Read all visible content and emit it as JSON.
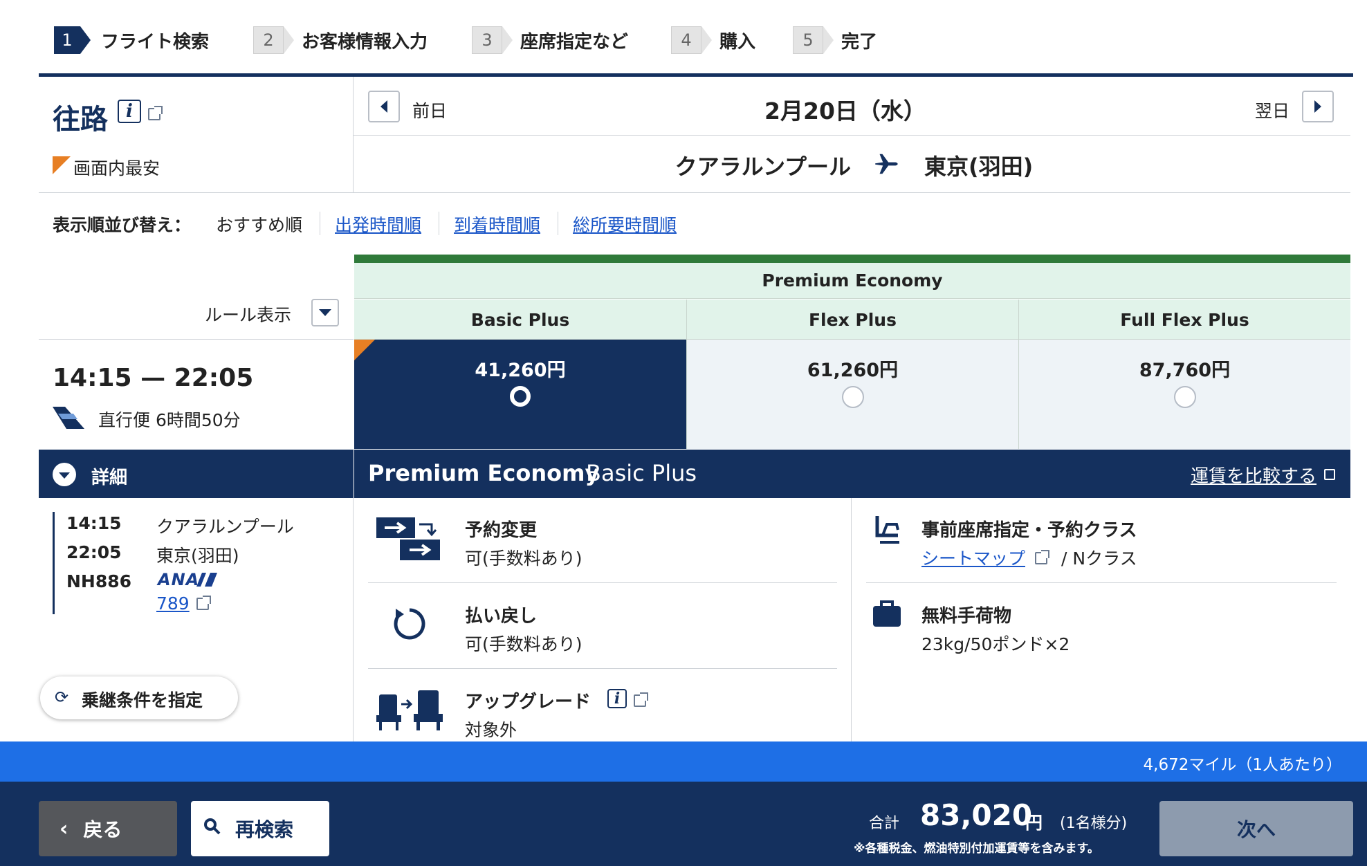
{
  "steps": [
    {
      "num": "1",
      "label": "フライト検索"
    },
    {
      "num": "2",
      "label": "お客様情報入力"
    },
    {
      "num": "3",
      "label": "座席指定など"
    },
    {
      "num": "4",
      "label": "購入"
    },
    {
      "num": "5",
      "label": "完了"
    }
  ],
  "header": {
    "direction": "往路",
    "info_glyph": "i",
    "cheapest_label": "画面内最安",
    "prev_day": "前日",
    "date": "2月20日（水）",
    "next_day": "翌日",
    "origin": "クアラルンプール",
    "destination": "東京(羽田)"
  },
  "sort": {
    "label": "表示順並び替え：",
    "options": [
      "おすすめ順",
      "出発時間順",
      "到着時間順",
      "総所要時間順"
    ]
  },
  "rules_toggle": "ルール表示",
  "flight": {
    "times": "14:15 — 22:05",
    "duration": "直行便 6時間50分",
    "detail_label": "詳細",
    "depart_time": "14:15",
    "depart_city": "クアラルンプール",
    "arrive_time": "22:05",
    "arrive_city": "東京(羽田)",
    "flight_no": "NH886",
    "airline_logo": "ANA",
    "aircraft": "789"
  },
  "connection_button": "乗継条件を指定",
  "fares": {
    "cabin": "Premium Economy",
    "options": [
      {
        "name": "Basic Plus",
        "price": "41,260円",
        "selected": true
      },
      {
        "name": "Flex Plus",
        "price": "61,260円",
        "selected": false
      },
      {
        "name": "Full Flex Plus",
        "price": "87,760円",
        "selected": false
      }
    ]
  },
  "selected_fare": {
    "cabin": "Premium Economy",
    "fare": "Basic Plus",
    "compare_link": "運賃を比較する"
  },
  "features": {
    "change": {
      "title": "予約変更",
      "value": "可(手数料あり)"
    },
    "refund": {
      "title": "払い戻し",
      "value": "可(手数料あり)"
    },
    "upgrade": {
      "title": "アップグレード",
      "value": "対象外"
    },
    "seat": {
      "title": "事前座席指定・予約クラス",
      "link": "シートマップ",
      "value": "/ Nクラス"
    },
    "baggage": {
      "title": "無料手荷物",
      "value": "23kg/50ポンド×2"
    }
  },
  "miles": "4,672マイル（1人あたり）",
  "footer": {
    "back": "戻る",
    "research": "再検索",
    "total_label": "合計",
    "total": "83,020",
    "currency": "円",
    "per": "(1名様分)",
    "note": "※各種税金、燃油特別付加運賃等を含みます。",
    "next": "次へ"
  },
  "colors": {
    "navy": "#14305e",
    "green": "#2f7a3a",
    "mint": "#e1f3ea",
    "blue": "#1e6fe6",
    "orange": "#e77f24",
    "link": "#1a56c8"
  }
}
